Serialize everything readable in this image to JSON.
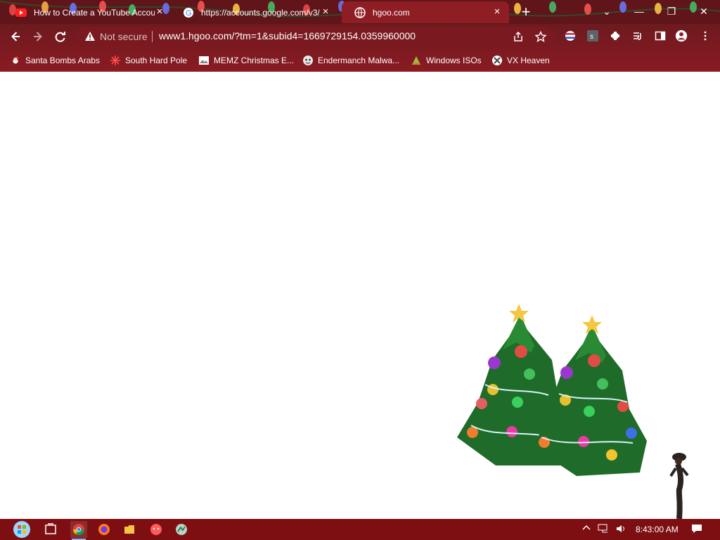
{
  "browser": {
    "tabs": [
      {
        "title": "How to Create a YouTube Accou",
        "icon": "youtube-icon",
        "active": false
      },
      {
        "title": "https://accounts.google.com/v3/",
        "icon": "google-icon",
        "active": false
      },
      {
        "title": "hgoo.com",
        "icon": "globe-icon",
        "active": true
      }
    ],
    "new_tab_label": "+",
    "window_controls": {
      "collapse": "⌄",
      "minimize": "—",
      "restore": "❐",
      "close": "✕"
    },
    "security_label": "Not secure",
    "url": "www1.hgoo.com/?tm=1&subid4=1669729154.0359960000",
    "bookmarks": [
      {
        "label": "Santa Bombs Arabs",
        "icon": "santa-icon"
      },
      {
        "label": "South Hard Pole",
        "icon": "snowflake-icon"
      },
      {
        "label": "MEMZ Christmas E...",
        "icon": "image-icon"
      },
      {
        "label": "Endermanch Malwa...",
        "icon": "mascot-icon"
      },
      {
        "label": "Windows ISOs",
        "icon": "folder-icon"
      },
      {
        "label": "VX Heaven",
        "icon": "vx-icon"
      }
    ]
  },
  "taskbar": {
    "time": "8:43:00 AM",
    "apps": [
      "chrome-icon",
      "firefox-icon",
      "explorer-icon",
      "malware-app-icon",
      "network-app-icon"
    ]
  },
  "colors": {
    "chrome": "#7e1f24",
    "taskbar": "#7d0f12"
  }
}
